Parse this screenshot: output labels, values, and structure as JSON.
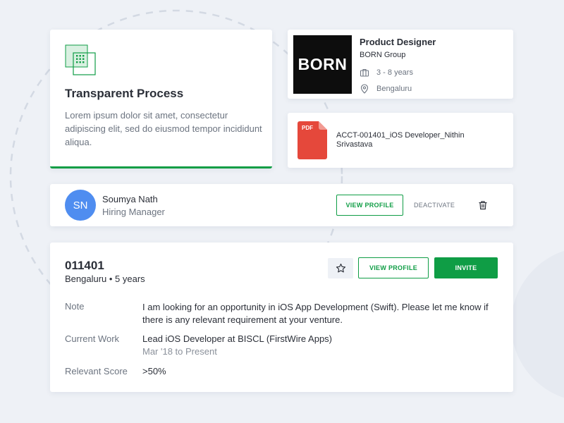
{
  "process_card": {
    "icon": "building-grid-icon",
    "title": "Transparent Process",
    "description": "Lorem ipsum dolor sit amet, consectetur adipiscing elit, sed do eiusmod tempor incididunt aliqua.",
    "accent_color": "#0f9d45"
  },
  "job_card": {
    "logo_text": "BORN",
    "title": "Product Designer",
    "company": "BORN Group",
    "experience": "3 - 8 years",
    "location": "Bengaluru"
  },
  "document_card": {
    "icon": "pdf-icon",
    "icon_label": "PDF",
    "file_name": "ACCT-001401_iOS Developer_Nithin Srivastava"
  },
  "user_card": {
    "avatar_initials": "SN",
    "avatar_color": "#4f8df0",
    "name": "Soumya Nath",
    "role": "Hiring Manager",
    "view_profile_label": "VIEW PROFILE",
    "deactivate_label": "DEACTIVATE"
  },
  "candidate_card": {
    "id": "011401",
    "subtitle": "Bengaluru • 5 years",
    "view_profile_label": "VIEW PROFILE",
    "invite_label": "INVITE",
    "details": {
      "note_label": "Note",
      "note_value": "I am looking for an opportunity in iOS App Development (Swift). Please let me know if there is any relevant requirement at your venture.",
      "work_label": "Current Work",
      "work_value": "Lead iOS Developer at BISCL (FirstWire Apps)",
      "work_period": "Mar '18 to Present",
      "score_label": "Relevant Score",
      "score_value": ">50%"
    }
  },
  "colors": {
    "primary_green": "#0f9d45",
    "background": "#eef1f6"
  }
}
